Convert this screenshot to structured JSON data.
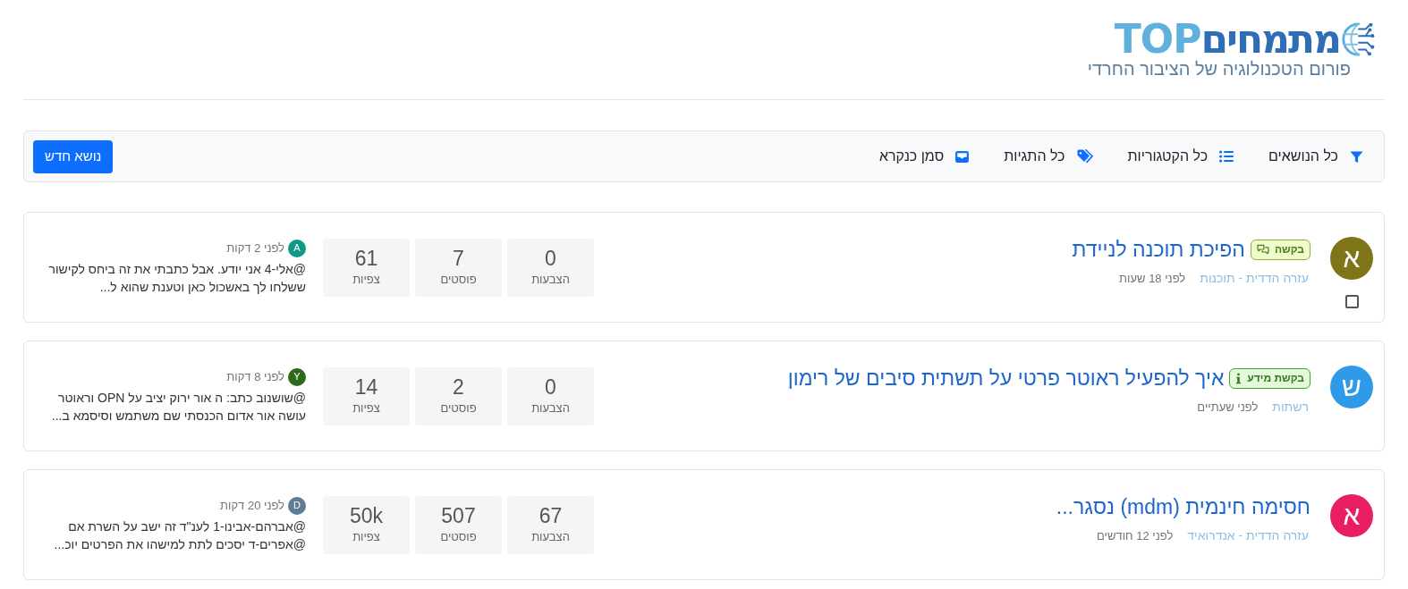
{
  "header": {
    "logo": {
      "title": "מתמחים",
      "brand": "TOP",
      "tagline": "פורום הטכנולוגיה של הציבור החרדי"
    }
  },
  "toolbar": {
    "items": [
      {
        "kind": "filter",
        "label": "כל הנושאים"
      },
      {
        "kind": "categories",
        "label": "כל הקטגוריות"
      },
      {
        "kind": "tags",
        "label": "כל התגיות"
      },
      {
        "kind": "mark_read",
        "label": "סמן כנקרא"
      }
    ],
    "new_topic_button": "נושא חדש"
  },
  "topics": [
    {
      "avatar": {
        "letter": "א",
        "color": "#7e7418"
      },
      "checked": false,
      "title": "הפיכת תוכנה לניידת",
      "tag": {
        "kind": "request",
        "label": "בקשה"
      },
      "category": "עזרה הדדית - תוכנות",
      "time": "לפני 18 שעות",
      "stats": [
        {
          "value": "0",
          "label": "הצבעות"
        },
        {
          "value": "7",
          "label": "פוסטים"
        },
        {
          "value": "61",
          "label": "צפיות"
        }
      ],
      "last_post": {
        "avatar": {
          "letter": "A",
          "color": "#0f9a86"
        },
        "time": "לפני 2 דקות",
        "text": "@אלי-4 אני יודע. אבל כתבתי את זה ביחס לקישור ששלחו לך באשכול כאן וטענת שהוא ל..."
      }
    },
    {
      "avatar": {
        "letter": "ש",
        "color": "#2f9be8"
      },
      "title": "איך להפעיל ראוטר פרטי על תשתית סיבים של רימון",
      "tag": {
        "kind": "info",
        "label": "בקשת מידע"
      },
      "category": "רשתות",
      "time": "לפני שעתיים",
      "stats": [
        {
          "value": "0",
          "label": "הצבעות"
        },
        {
          "value": "2",
          "label": "פוסטים"
        },
        {
          "value": "14",
          "label": "צפיות"
        }
      ],
      "last_post": {
        "avatar": {
          "letter": "Y",
          "color": "#2e6a1c"
        },
        "time": "לפני 8 דקות",
        "text": "@שושנוב כתב: ה אור ירוק יציב על OPN וראוטר עושה אור אדום הכנסתי שם משתמש וסיסמא ב..."
      }
    },
    {
      "avatar": {
        "letter": "א",
        "color": "#e91e63"
      },
      "title": "חסימה חינמית (mdm) נסגר...",
      "category": "עזרה הדדית - אנדרואיד",
      "time": "לפני 12 חודשים",
      "stats": [
        {
          "value": "67",
          "label": "הצבעות"
        },
        {
          "value": "507",
          "label": "פוסטים"
        },
        {
          "value": "50k",
          "label": "צפיות"
        }
      ],
      "last_post": {
        "avatar": {
          "letter": "D",
          "color": "#5e7c93"
        },
        "time": "לפני 20 דקות",
        "text": "@אברהם-אבינו-1 לענ\"ד זה ישב על השרת אם @אפרים-ד יסכים לתת למישהו את הפרטים יוכ..."
      }
    }
  ]
}
